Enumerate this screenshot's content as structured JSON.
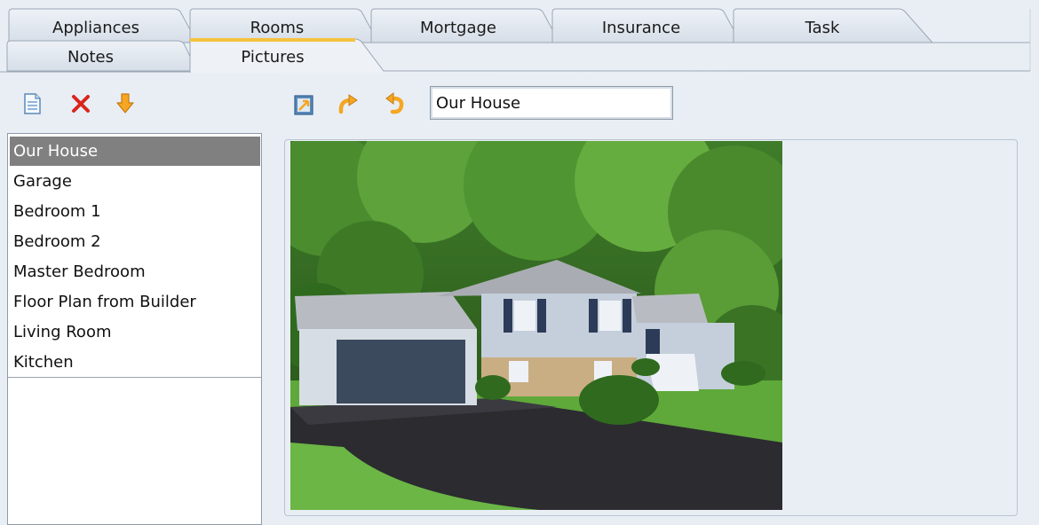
{
  "tabs_row1": [
    {
      "label": "Appliances"
    },
    {
      "label": "Rooms"
    },
    {
      "label": "Mortgage"
    },
    {
      "label": "Insurance"
    },
    {
      "label": "Task"
    }
  ],
  "tabs_row2": [
    {
      "label": "Notes",
      "active": false
    },
    {
      "label": "Pictures",
      "active": true
    }
  ],
  "list_toolbar": {
    "icons": [
      "new-document-icon",
      "delete-icon",
      "move-down-icon"
    ]
  },
  "picture_toolbar": {
    "icons": [
      "load-picture-icon",
      "rotate-right-icon",
      "rotate-left-icon"
    ]
  },
  "picture_name": {
    "value": "Our House"
  },
  "picture_list": {
    "selected": "Our House",
    "items": [
      {
        "label": "Our House"
      },
      {
        "label": "Garage"
      },
      {
        "label": "Bedroom 1"
      },
      {
        "label": "Bedroom 2"
      },
      {
        "label": "Master Bedroom"
      },
      {
        "label": "Floor Plan from Builder"
      },
      {
        "label": "Living Room"
      },
      {
        "label": "Kitchen"
      }
    ]
  },
  "colors": {
    "background": "#e9eef5",
    "active_tab_accent": "#f6c23e",
    "selection": "#808080",
    "delete_red": "#d9261c",
    "arrow_orange": "#f5a623"
  }
}
